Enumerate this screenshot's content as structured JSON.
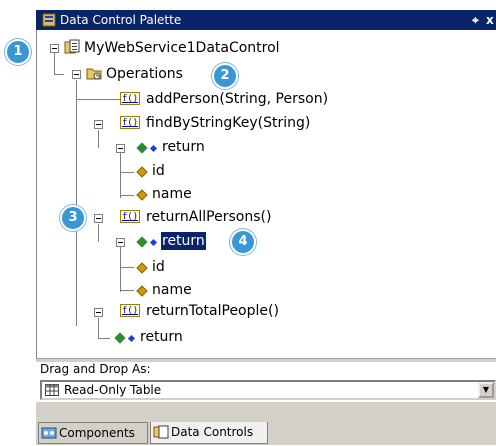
{
  "window": {
    "title": "Data Control Palette",
    "pin_glyph": "$",
    "close_glyph": "x"
  },
  "tree": {
    "root": "MyWebService1DataControl",
    "operations": "Operations",
    "addPerson": "addPerson(String, Person)",
    "findByStringKey": "findByStringKey(String)",
    "find_return": "return",
    "find_id": "id",
    "find_name": "name",
    "returnAllPersons": "returnAllPersons()",
    "all_return": "return",
    "all_id": "id",
    "all_name": "name",
    "returnTotalPeople": "returnTotalPeople()",
    "total_return": "return",
    "f_icon_text": "f()"
  },
  "callouts": [
    "1",
    "2",
    "3",
    "4"
  ],
  "drag_drop": {
    "label": "Drag and Drop As:",
    "selected": "Read-Only Table"
  },
  "tabs": [
    {
      "label": "Components"
    },
    {
      "label": "Data Controls"
    }
  ],
  "colors": {
    "titlebar": "#0a246a",
    "callout": "#3a97d6",
    "selection": "#0a246a"
  }
}
